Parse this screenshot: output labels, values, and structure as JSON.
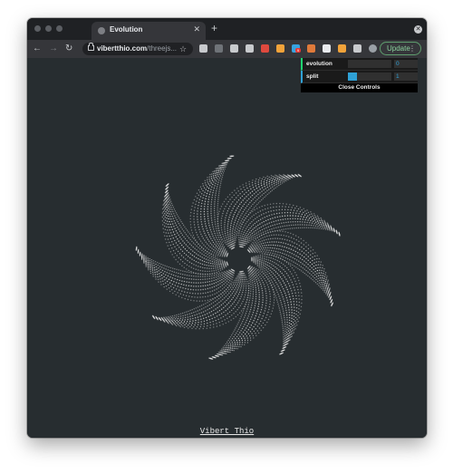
{
  "browser": {
    "tab": {
      "title": "Evolution"
    },
    "url": {
      "domain": "vibertthio.com",
      "path": "/threejs..."
    },
    "update_label": "Update",
    "extensions": [
      {
        "name": "ext-grid-icon",
        "color": "#c8cacd"
      },
      {
        "name": "ext-link-icon",
        "color": "#6f7378"
      },
      {
        "name": "ext-glasses-icon",
        "color": "#c8cacd"
      },
      {
        "name": "ext-compass-icon",
        "color": "#c8cacd"
      },
      {
        "name": "ext-red-icon",
        "color": "#e0493e"
      },
      {
        "name": "ext-orange-dot-icon",
        "color": "#f2a33a"
      },
      {
        "name": "ext-multi-icon",
        "color": "#37a3e0",
        "badge": "9"
      },
      {
        "name": "ext-shield-icon",
        "color": "#e07a3a"
      },
      {
        "name": "ext-box-icon",
        "color": "#e8eaed"
      },
      {
        "name": "ext-flag-icon",
        "color": "#f2a33a"
      },
      {
        "name": "ext-puzzle-icon",
        "color": "#c8cacd"
      },
      {
        "name": "profile-avatar-icon",
        "color": "#9aa0a6"
      }
    ]
  },
  "controls": {
    "rows": [
      {
        "label": "evolution",
        "value": "0",
        "fraction": 0
      },
      {
        "label": "split",
        "value": "1",
        "fraction": 0.2
      }
    ],
    "close_label": "Close Controls"
  },
  "footer": {
    "credit": "Vibert Thio"
  },
  "colors": {
    "page_bg": "#272d30",
    "accent": "#2fa1d6",
    "particles": "#e8e8e8"
  }
}
